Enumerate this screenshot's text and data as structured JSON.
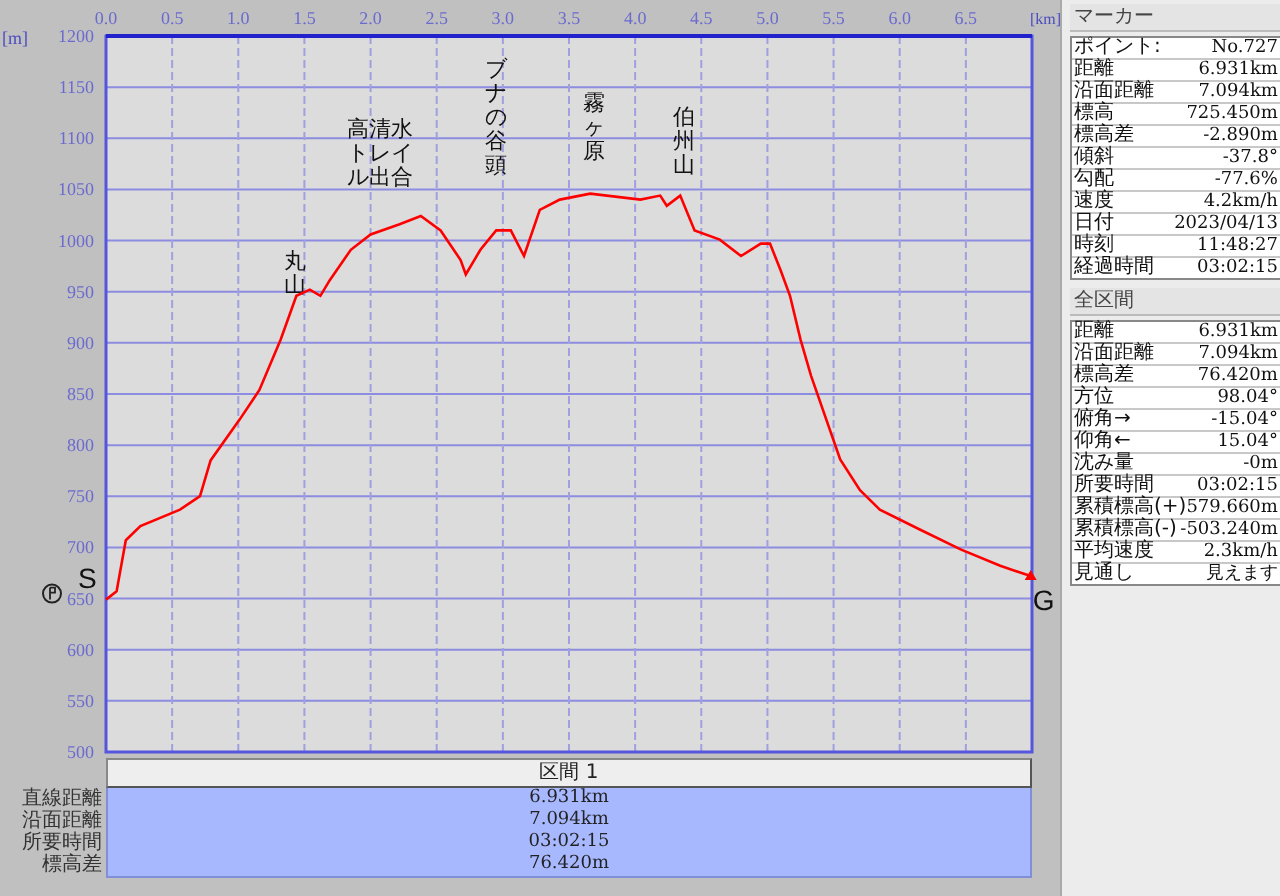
{
  "chart": {
    "chart_data": {
      "type": "line",
      "xlabel": "[km]",
      "ylabel": "[m]",
      "xlim": [
        0,
        7
      ],
      "ylim": [
        500,
        1200
      ],
      "xticks": [
        {
          "value": 0,
          "label": "0.0"
        },
        {
          "value": 0.5,
          "label": "0.5"
        },
        {
          "value": 1,
          "label": "1.0"
        },
        {
          "value": 1.5,
          "label": "1.5"
        },
        {
          "value": 2,
          "label": "2.0"
        },
        {
          "value": 2.5,
          "label": "2.5"
        },
        {
          "value": 3,
          "label": "3.0"
        },
        {
          "value": 3.5,
          "label": "3.5"
        },
        {
          "value": 4,
          "label": "4.0"
        },
        {
          "value": 4.5,
          "label": "4.5"
        },
        {
          "value": 5,
          "label": "5.0"
        },
        {
          "value": 5.5,
          "label": "5.5"
        },
        {
          "value": 6,
          "label": "6.0"
        },
        {
          "value": 6.5,
          "label": "6.5"
        }
      ],
      "yticks": [
        500,
        550,
        600,
        650,
        700,
        750,
        800,
        850,
        900,
        950,
        1000,
        1050,
        1100,
        1150,
        1200
      ],
      "x": [
        0,
        0.08,
        0.15,
        0.26,
        0.56,
        0.71,
        0.79,
        1.01,
        1.16,
        1.32,
        1.44,
        1.54,
        1.62,
        1.69,
        1.85,
        2.0,
        2.22,
        2.38,
        2.53,
        2.68,
        2.72,
        2.83,
        2.95,
        3.06,
        3.16,
        3.28,
        3.43,
        3.66,
        4.04,
        4.19,
        4.24,
        4.34,
        4.45,
        4.64,
        4.8,
        4.95,
        5.02,
        5.1,
        5.17,
        5.25,
        5.33,
        5.55,
        5.7,
        5.85,
        6.16,
        6.46,
        6.76,
        6.99
      ],
      "series": [
        {
          "color": "#ff0000",
          "values": [
            649,
            657,
            707,
            721,
            737,
            750,
            785,
            825,
            854,
            903,
            946,
            952,
            946,
            961,
            991,
            1006,
            1016,
            1024,
            1010,
            981,
            967,
            991,
            1010,
            1010,
            985,
            1030,
            1040,
            1046,
            1040,
            1044,
            1034,
            1044,
            1010,
            1001,
            985,
            997,
            997,
            971,
            946,
            903,
            868,
            786,
            756,
            737,
            717,
            698,
            682,
            672
          ]
        }
      ],
      "grid": true,
      "annotations": [
        "丸山",
        "高清水トレイル出合",
        "ブナの谷頭",
        "霧ヶ原",
        "伯州山"
      ]
    },
    "markers": [
      {
        "kind": "start",
        "label": "S"
      },
      {
        "kind": "goal",
        "label": "G"
      }
    ]
  },
  "section_table": {
    "header": "区間 1",
    "rows": [
      {
        "label": "直線距離",
        "value": "6.931km"
      },
      {
        "label": "沿面距離",
        "value": "7.094km"
      },
      {
        "label": "所要時間",
        "value": "03:02:15"
      },
      {
        "label": "標高差",
        "value": "76.420m"
      }
    ]
  },
  "marker_panel": {
    "title": "マーカー",
    "rows": [
      {
        "label": "ポイント:",
        "value": "No.727"
      },
      {
        "label": "距離",
        "value": "6.931km"
      },
      {
        "label": "沿面距離",
        "value": "7.094km"
      },
      {
        "label": "標高",
        "value": "725.450m"
      },
      {
        "label": "標高差",
        "value": "-2.890m"
      },
      {
        "label": "傾斜",
        "value": "-37.8°"
      },
      {
        "label": "勾配",
        "value": "-77.6%"
      },
      {
        "label": "速度",
        "value": "4.2km/h"
      },
      {
        "label": "日付",
        "value": "2023/04/13"
      },
      {
        "label": "時刻",
        "value": "11:48:27"
      },
      {
        "label": "経過時間",
        "value": "03:02:15"
      }
    ]
  },
  "overall_panel": {
    "title": "全区間",
    "rows": [
      {
        "label": "距離",
        "value": "6.931km"
      },
      {
        "label": "沿面距離",
        "value": "7.094km"
      },
      {
        "label": "標高差",
        "value": "76.420m"
      },
      {
        "label": "方位",
        "value": "98.04°"
      },
      {
        "label": "俯角→",
        "value": "-15.04°"
      },
      {
        "label": "仰角←",
        "value": "15.04°"
      },
      {
        "label": "沈み量",
        "value": "-0m"
      },
      {
        "label": "所要時間",
        "value": "03:02:15"
      },
      {
        "label": "累積標高(+)",
        "value": "579.660m"
      },
      {
        "label": "累積標高(-)",
        "value": "-503.240m"
      },
      {
        "label": "平均速度",
        "value": "2.3km/h"
      },
      {
        "label": "見通し",
        "value": "見えます"
      }
    ]
  }
}
